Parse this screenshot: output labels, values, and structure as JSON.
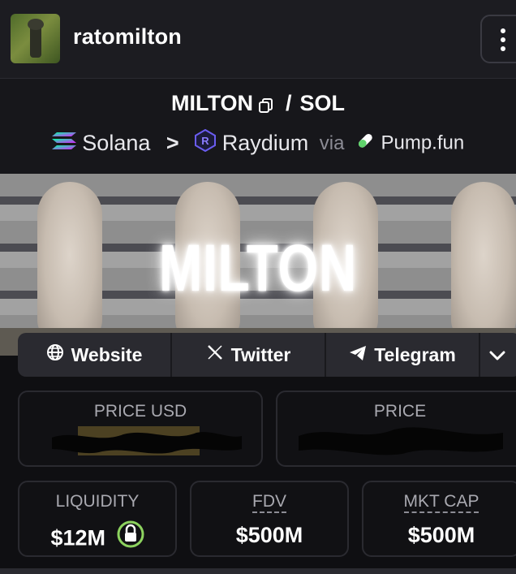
{
  "header": {
    "username": "ratomilton"
  },
  "pair": {
    "base": "MILTON",
    "separator": "/",
    "quote": "SOL"
  },
  "chain": {
    "network": "Solana",
    "arrow": ">",
    "dex": "Raydium",
    "via": "via",
    "launchpad": "Pump.fun"
  },
  "banner": {
    "text": "MILTON"
  },
  "links": {
    "website": "Website",
    "twitter": "Twitter",
    "telegram": "Telegram"
  },
  "stats": {
    "price_usd_label": "PRICE USD",
    "price_label": "PRICE",
    "liquidity_label": "LIQUIDITY",
    "liquidity_value": "$12M",
    "fdv_label": "FDV",
    "fdv_value": "$500M",
    "mktcap_label": "MKT CAP",
    "mktcap_value": "$500M"
  },
  "colors": {
    "background": "#0f0f12",
    "panel": "#1c1c21",
    "box_border": "#2a2a30",
    "lock_green": "#8dd35f",
    "raydium_purple": "#6a5cf0"
  },
  "icons": [
    "kebab-menu-icon",
    "copy-icon",
    "solana-icon",
    "raydium-icon",
    "pill-icon",
    "globe-icon",
    "x-icon",
    "telegram-icon",
    "chevron-down-icon",
    "lock-icon"
  ]
}
